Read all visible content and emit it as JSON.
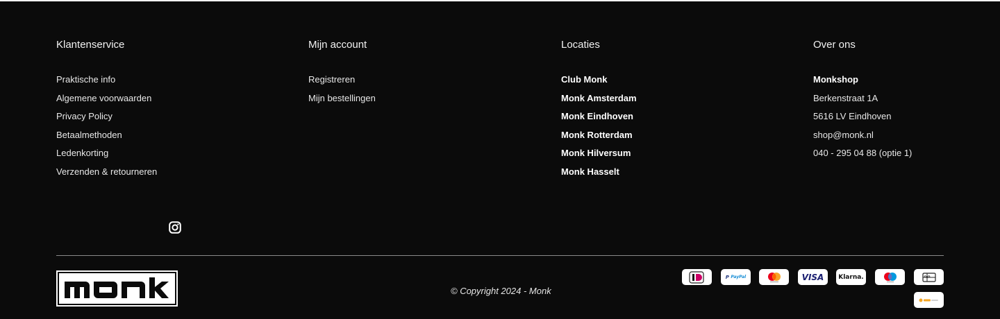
{
  "columns": [
    {
      "title": "Klantenservice",
      "items": [
        "Praktische info",
        "Algemene voorwaarden",
        "Privacy Policy",
        "Betaalmethoden",
        "Ledenkorting",
        "Verzenden & retourneren"
      ]
    },
    {
      "title": "Mijn account",
      "items": [
        "Registreren",
        "Mijn bestellingen"
      ]
    },
    {
      "title": "Locaties",
      "items": [
        "Club Monk",
        "Monk Amsterdam",
        "Monk Eindhoven",
        "Monk Rotterdam",
        "Monk Hilversum",
        "Monk Hasselt"
      ]
    },
    {
      "title": "Over ons",
      "items": [
        "Monkshop",
        "Berkenstraat 1A",
        "5616 LV Eindhoven",
        "shop@monk.nl",
        "040 - 295 04 88 (optie 1)"
      ]
    }
  ],
  "social": {
    "icon": "instagram-icon"
  },
  "brand": {
    "logo_text": "monk"
  },
  "copyright": "© Copyright 2024 - Monk",
  "payments": {
    "paypal": "PayPal",
    "visa": "VISA",
    "klarna": "Klarna."
  },
  "colors": {
    "background": "#0b0b0b",
    "text": "#e6e6e6",
    "divider": "#8a8a8a"
  }
}
